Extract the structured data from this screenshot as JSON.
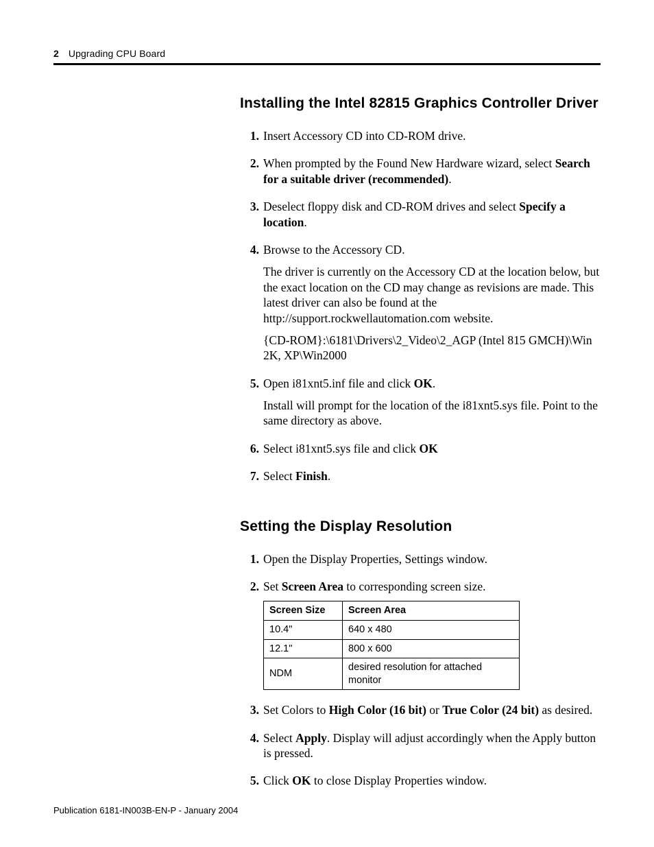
{
  "header": {
    "page_number": "2",
    "running_title": "Upgrading CPU Board"
  },
  "sections": [
    {
      "heading": "Installing the Intel 82815 Graphics Controller Driver",
      "steps": [
        {
          "n": "1.",
          "runs": [
            {
              "t": "Insert Accessory CD into CD-ROM drive."
            }
          ]
        },
        {
          "n": "2.",
          "runs": [
            {
              "t": "When prompted by the Found New Hardware wizard, select "
            },
            {
              "t": "Search for a suitable driver (recommended)",
              "b": true
            },
            {
              "t": "."
            }
          ]
        },
        {
          "n": "3.",
          "runs": [
            {
              "t": "Deselect floppy disk and CD-ROM drives and select "
            },
            {
              "t": "Specify a location",
              "b": true
            },
            {
              "t": "."
            }
          ]
        },
        {
          "n": "4.",
          "runs": [
            {
              "t": "Browse to the Accessory CD."
            }
          ],
          "paras": [
            {
              "runs": [
                {
                  "t": "The driver is currently on the Accessory CD at the location below, but the exact location on the CD may change as revisions are made.  This latest driver can also be found at the http://support.rockwellautomation.com website."
                }
              ]
            },
            {
              "runs": [
                {
                  "t": "{CD-ROM}:\\6181\\Drivers\\2_Video\\2_AGP (Intel 815 GMCH)\\Win 2K, XP\\Win2000"
                }
              ]
            }
          ]
        },
        {
          "n": "5.",
          "runs": [
            {
              "t": "Open i81xnt5.inf file and click "
            },
            {
              "t": "OK",
              "b": true
            },
            {
              "t": "."
            }
          ],
          "paras": [
            {
              "runs": [
                {
                  "t": "Install will prompt for the location of the i81xnt5.sys file. Point to the same directory as above."
                }
              ]
            }
          ]
        },
        {
          "n": "6.",
          "runs": [
            {
              "t": "Select i81xnt5.sys file and click "
            },
            {
              "t": "OK",
              "b": true
            }
          ]
        },
        {
          "n": "7.",
          "runs": [
            {
              "t": "Select "
            },
            {
              "t": "Finish",
              "b": true
            },
            {
              "t": "."
            }
          ]
        }
      ]
    },
    {
      "heading": "Setting the Display Resolution",
      "steps": [
        {
          "n": "1.",
          "runs": [
            {
              "t": "Open the Display Properties, Settings window."
            }
          ]
        },
        {
          "n": "2.",
          "runs": [
            {
              "t": "Set "
            },
            {
              "t": "Screen Area",
              "b": true
            },
            {
              "t": " to corresponding screen size."
            }
          ],
          "table": {
            "headers": [
              "Screen Size",
              "Screen Area"
            ],
            "rows": [
              [
                "10.4\"",
                "640 x 480"
              ],
              [
                "12.1\"",
                "800 x 600"
              ],
              [
                "NDM",
                "desired resolution for attached monitor"
              ]
            ]
          }
        },
        {
          "n": "3.",
          "runs": [
            {
              "t": "Set Colors to "
            },
            {
              "t": "High Color (16 bit)",
              "b": true
            },
            {
              "t": " or "
            },
            {
              "t": "True Color (24 bit)",
              "b": true
            },
            {
              "t": " as desired."
            }
          ]
        },
        {
          "n": "4.",
          "runs": [
            {
              "t": "Select "
            },
            {
              "t": "Apply",
              "b": true
            },
            {
              "t": ". Display will adjust accordingly when the Apply button is pressed."
            }
          ]
        },
        {
          "n": "5.",
          "runs": [
            {
              "t": "Click "
            },
            {
              "t": "OK",
              "b": true
            },
            {
              "t": " to close Display Properties window."
            }
          ]
        }
      ]
    }
  ],
  "footer": {
    "publine": "Publication 6181-IN003B-EN-P - January 2004"
  }
}
